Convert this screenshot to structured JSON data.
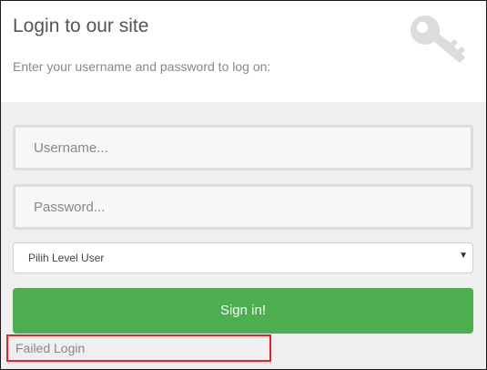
{
  "header": {
    "title": "Login to our site",
    "subtitle": "Enter your username and password to log on:"
  },
  "form": {
    "username_placeholder": "Username...",
    "password_placeholder": "Password...",
    "level_select_value": "Pilih Level User",
    "signin_label": "Sign in!"
  },
  "status": {
    "message": "Failed Login"
  },
  "colors": {
    "signin_green": "#4cae4f",
    "highlight_red": "#e8202a",
    "body_gray": "#efefef"
  },
  "icons": {
    "header_icon": "key-icon",
    "select_icon": "caret-down-icon"
  }
}
